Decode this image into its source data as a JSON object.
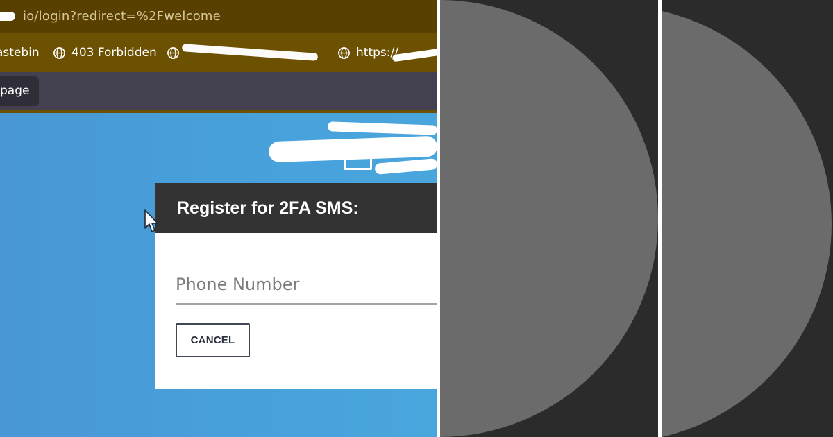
{
  "browser": {
    "address_text": "io/login?redirect=%2Fwelcome",
    "bookmarks": [
      {
        "label": "astebin",
        "icon": "none"
      },
      {
        "label": "403 Forbidden",
        "icon": "globe-icon"
      },
      {
        "label": "",
        "icon": "globe-icon"
      },
      {
        "label": "https://",
        "icon": "globe-icon"
      }
    ],
    "tab_label": "page"
  },
  "modal": {
    "title": "Register for 2FA SMS:",
    "phone_placeholder": "Phone Number",
    "cancel_label": "CANCEL"
  },
  "colors": {
    "address_bar": "#584100",
    "bookmark_bar": "#6d5102",
    "page_blue": "#489fda",
    "modal_header": "#333333",
    "placeholder_grey": "#7b7b7b",
    "right_panel_grey": "#6b6b6b",
    "dark_background": "#2b2b2b"
  }
}
